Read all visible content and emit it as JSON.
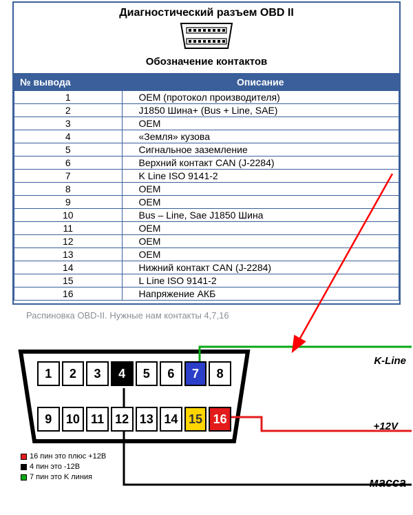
{
  "header": {
    "title": "Диагностический разъем OBD II",
    "subtitle": "Обозначение контактов"
  },
  "table": {
    "head": {
      "col1": "№ вывода",
      "col2": "Описание"
    },
    "rows": [
      {
        "n": "1",
        "d": "OEM (протокол производителя)"
      },
      {
        "n": "2",
        "d": "J1850 Шина+ (Bus + Line, SAE)"
      },
      {
        "n": "3",
        "d": "OEM"
      },
      {
        "n": "4",
        "d": "«Земля» кузова"
      },
      {
        "n": "5",
        "d": "Сигнальное заземление"
      },
      {
        "n": "6",
        "d": "Верхний контакт CAN (J-2284)"
      },
      {
        "n": "7",
        "d": "K Line ISO 9141-2"
      },
      {
        "n": "8",
        "d": "OEM"
      },
      {
        "n": "9",
        "d": "OEM"
      },
      {
        "n": "10",
        "d": "Bus – Line, Sae J1850 Шина"
      },
      {
        "n": "11",
        "d": "OEM"
      },
      {
        "n": "12",
        "d": "OEM"
      },
      {
        "n": "13",
        "d": "OEM"
      },
      {
        "n": "14",
        "d": "Нижний контакт CAN (J-2284)"
      },
      {
        "n": "15",
        "d": "L Line ISO 9141-2"
      },
      {
        "n": "16",
        "d": "Напряжение АКБ"
      }
    ]
  },
  "caption": "Распиновка OBD-II. Нужные нам контакты 4,7,16",
  "diagram": {
    "pins_top": [
      {
        "n": "1"
      },
      {
        "n": "2"
      },
      {
        "n": "3"
      },
      {
        "n": "4",
        "cls": "blk"
      },
      {
        "n": "5"
      },
      {
        "n": "6"
      },
      {
        "n": "7",
        "cls": "blu"
      },
      {
        "n": "8"
      }
    ],
    "pins_bot": [
      {
        "n": "9"
      },
      {
        "n": "10"
      },
      {
        "n": "11"
      },
      {
        "n": "12"
      },
      {
        "n": "13"
      },
      {
        "n": "14"
      },
      {
        "n": "15",
        "cls": "yel"
      },
      {
        "n": "16",
        "cls": "red"
      }
    ],
    "legend": {
      "l1": "16 пин это плюс +12В",
      "l2": "4 пин это -12В",
      "l3": "7 пин это K линия"
    },
    "labels": {
      "kline": "K-Line",
      "v12": "+12V",
      "mass": "масса"
    }
  },
  "colors": {
    "frame": "#3a5f9a",
    "kline": "#0aa814",
    "v12": "#e31b1b",
    "mass": "#000000",
    "arrow": "#ff0000"
  }
}
